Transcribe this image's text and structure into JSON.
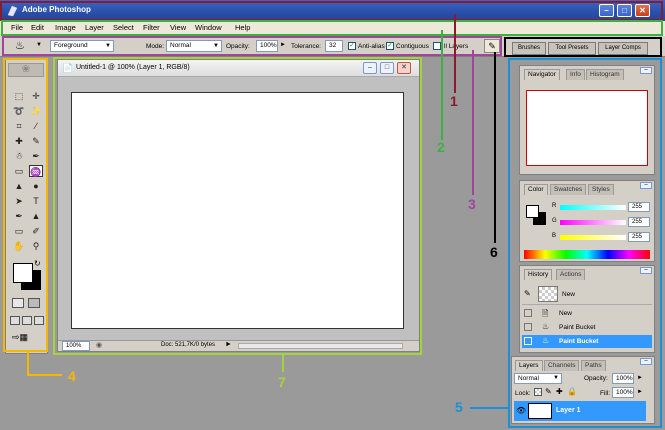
{
  "window": {
    "title": "Adobe Photoshop",
    "min": "–",
    "max": "□",
    "close": "✕"
  },
  "menu": [
    "File",
    "Edit",
    "Image",
    "Layer",
    "Select",
    "Filter",
    "View",
    "Window",
    "Help"
  ],
  "options": {
    "fill_source": "Foreground",
    "mode_label": "Mode:",
    "mode_value": "Normal",
    "opacity_label": "Opacity:",
    "opacity_value": "100%",
    "tolerance_label": "Tolerance:",
    "tolerance_value": "32",
    "antialias_label": "Anti-alias",
    "contiguous_label": "Contiguous",
    "all_layers_label": "ll Layers"
  },
  "palette_well": [
    "Brushes",
    "Tool Presets",
    "Layer Comps"
  ],
  "document": {
    "title": "Untitled-1 @ 100% (Layer 1, RGB/8)",
    "zoom": "100%",
    "doc_info": "Doc: 521,7K/0 bytes"
  },
  "navigator": {
    "tabs": [
      "Navigator",
      "Info",
      "Histogram"
    ]
  },
  "color": {
    "tabs": [
      "Color",
      "Swatches",
      "Styles"
    ],
    "channels": [
      {
        "label": "R",
        "value": "255"
      },
      {
        "label": "G",
        "value": "255"
      },
      {
        "label": "B",
        "value": "255"
      }
    ]
  },
  "history": {
    "tabs": [
      "History",
      "Actions"
    ],
    "snapshot": "New",
    "items": [
      "New",
      "Paint Bucket",
      "Paint Bucket"
    ]
  },
  "layers": {
    "tabs": [
      "Layers",
      "Channels",
      "Paths"
    ],
    "blend_mode": "Normal",
    "opacity_label": "Opacity:",
    "opacity_value": "100%",
    "lock_label": "Lock:",
    "fill_label": "Fill:",
    "fill_value": "100%",
    "layer_name": "Layer 1"
  },
  "annotations": [
    "1",
    "2",
    "3",
    "4",
    "5",
    "6",
    "7"
  ],
  "colors": {
    "annot_1": "#8b1a2a",
    "annot_2": "#3cb043",
    "annot_3": "#a0459a",
    "annot_4": "#f5b800",
    "annot_5": "#1c8fd6",
    "annot_6": "#000000",
    "annot_7": "#a6d23c",
    "selection_blue": "#3399ff"
  }
}
